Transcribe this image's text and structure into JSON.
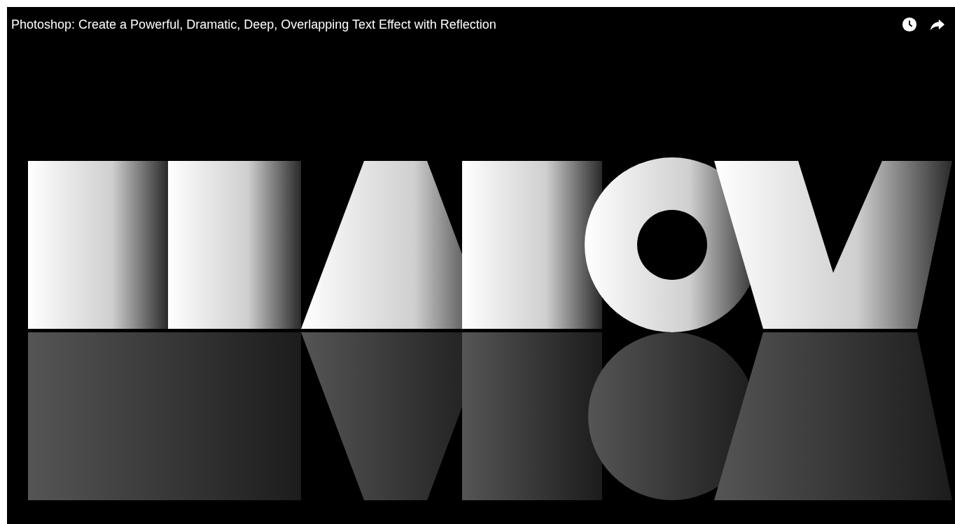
{
  "player": {
    "title": "Photoshop: Create a Powerful, Dramatic, Deep, Overlapping Text Effect with Reflection"
  }
}
